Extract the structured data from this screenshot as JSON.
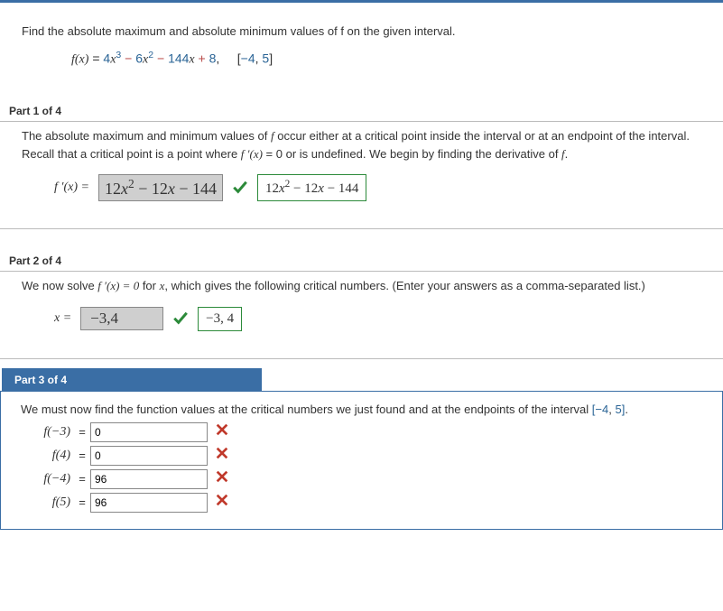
{
  "stem": {
    "prompt": "Find the absolute maximum and absolute minimum values of f on the given interval.",
    "fx_label": "f(x)",
    "eq_sign": "=",
    "term_a": "4",
    "var_x": "x",
    "exp3": "3",
    "minus": "−",
    "term_b": "6",
    "exp2": "2",
    "term_c": "144",
    "plus": "+",
    "term_d": "8",
    "comma_sep": ",",
    "interval": "[−4, 5]",
    "interval_l": "[",
    "interval_a": "−4",
    "interval_sep": ",",
    "interval_b": "5",
    "interval_r": "]"
  },
  "part1": {
    "header": "Part 1 of 4",
    "text_a": "The absolute maximum and minimum values of ",
    "text_b": " occur either at a critical point inside the interval or at an endpoint of the interval. Recall that a critical point is a point where ",
    "fprime": "f ′(x)",
    "eq_zero": " = 0",
    "text_c": " or is undefined. We begin by finding the derivative of ",
    "f": "f",
    "period": ".",
    "answer_label": "f ′(x) = ",
    "student_answer": "12x² − 12x − 144",
    "sa_12a": "12",
    "sa_exp2": "2",
    "sa_12b": "12",
    "sa_144": "144",
    "correct_answer": "12x² − 12x − 144"
  },
  "part2": {
    "header": "Part 2 of 4",
    "text_a": "We now solve  ",
    "fprime": "f ′(x) = 0",
    "text_b": "  for ",
    "varx": "x",
    "text_c": ", which gives the following critical numbers. (Enter your answers as a comma-separated list.)",
    "answer_label": "x = ",
    "student_answer": "−3,4",
    "correct_answer": "−3, 4"
  },
  "part3": {
    "header": "Part 3 of 4",
    "text_a": "We must now find the function values at the critical numbers we just found and at the endpoints of the interval ",
    "interval": "[−4, 5]",
    "period": ".",
    "rows": [
      {
        "label": "f(−3)",
        "value": "0"
      },
      {
        "label": "f(4)",
        "value": "0"
      },
      {
        "label": "f(−4)",
        "value": "96"
      },
      {
        "label": "f(5)",
        "value": "96"
      }
    ]
  },
  "glyphs": {
    "eq": "="
  }
}
